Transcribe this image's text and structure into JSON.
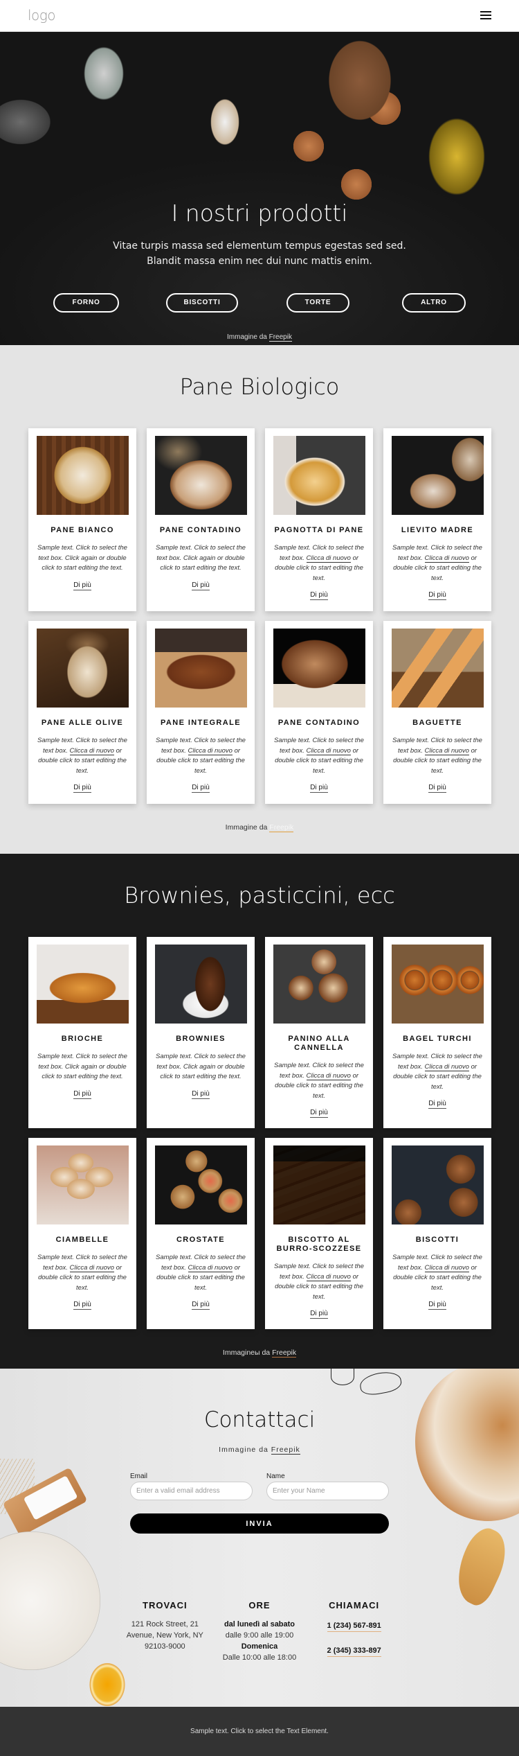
{
  "header": {
    "logo": "logo",
    "menu_icon": "hamburger-menu-icon"
  },
  "hero": {
    "title": "I nostri prodotti",
    "text_line1": "Vitae turpis massa sed elementum tempus egestas sed sed.",
    "text_line2": "Blandit massa enim nec dui nunc mattis enim.",
    "buttons": [
      "FORNO",
      "BISCOTTI",
      "TORTE",
      "ALTRO"
    ],
    "credit_prefix": "Immagine da",
    "credit_link": "Freepik"
  },
  "bread_section": {
    "title": "Pane Biologico",
    "credit_prefix": "Immagine da",
    "credit_link": "Freepik",
    "cards": [
      {
        "name": "PANE BIANCO",
        "desc_pre": "Sample text. Click to select the text box. Click again or double click to start editing the text.",
        "link": "",
        "desc_post": "",
        "more": "Di più"
      },
      {
        "name": "PANE CONTADINO",
        "desc_pre": "Sample text. Click to select the text box. Click again or double click to start editing the text.",
        "link": "",
        "desc_post": "",
        "more": "Di più"
      },
      {
        "name": "PAGNOTTA DI PANE",
        "desc_pre": "Sample text. Click to select the text box. ",
        "link": "Clicca di nuovo",
        "desc_post": " or double click to start editing the text.",
        "more": "Di più"
      },
      {
        "name": "LIEVITO MADRE",
        "desc_pre": "Sample text. Click to select the text box. ",
        "link": "Clicca di nuovo",
        "desc_post": " or double click to start editing the text.",
        "more": "Di più"
      },
      {
        "name": "PANE ALLE OLIVE",
        "desc_pre": "Sample text. Click to select the text box. ",
        "link": "Clicca di nuovo",
        "desc_post": " or double click to start editing the text.",
        "more": "Di più"
      },
      {
        "name": "PANE INTEGRALE",
        "desc_pre": "Sample text. Click to select the text box. ",
        "link": "Clicca di nuovo",
        "desc_post": " or double click to start editing the text.",
        "more": "Di più"
      },
      {
        "name": "PANE CONTADINO",
        "desc_pre": "Sample text. Click to select the text box. ",
        "link": "Clicca di nuovo",
        "desc_post": " or double click to start editing the text.",
        "more": "Di più"
      },
      {
        "name": "BAGUETTE",
        "desc_pre": "Sample text. Click to select the text box. ",
        "link": "Clicca di nuovo",
        "desc_post": " or double click to start editing the text.",
        "more": "Di più"
      }
    ]
  },
  "pastry_section": {
    "title": "Brownies, pasticcini, ecc",
    "credit_prefix": "Immagineы da",
    "credit_link": "Freepik",
    "cards": [
      {
        "name": "BRIOCHE",
        "desc_pre": "Sample text. Click to select the text box. Click again or double click to start editing the text.",
        "link": "",
        "desc_post": "",
        "more": "Di più"
      },
      {
        "name": "BROWNIES",
        "desc_pre": "Sample text. Click to select the text box. Click again or double click to start editing the text.",
        "link": "",
        "desc_post": "",
        "more": "Di più"
      },
      {
        "name": "PANINO ALLA CANNELLA",
        "desc_pre": "Sample text. Click to select the text box. ",
        "link": "Clicca di nuovo",
        "desc_post": " or double click to start editing the text.",
        "more": "Di più"
      },
      {
        "name": "BAGEL TURCHI",
        "desc_pre": "Sample text. Click to select the text box. ",
        "link": "Clicca di nuovo",
        "desc_post": " or double click to start editing the text.",
        "more": "Di più"
      },
      {
        "name": "CIAMBELLE",
        "desc_pre": "Sample text. Click to select the text box. ",
        "link": "Clicca di nuovo",
        "desc_post": " or double click to start editing the text.",
        "more": "Di più"
      },
      {
        "name": "CROSTATE",
        "desc_pre": "Sample text. Click to select the text box. ",
        "link": "Clicca di nuovo",
        "desc_post": " or double click to start editing the text.",
        "more": "Di più"
      },
      {
        "name": "BISCOTTO AL BURRO-SCOZZESE",
        "desc_pre": "Sample text. Click to select the text box. ",
        "link": "Clicca di nuovo",
        "desc_post": " or double click to start editing the text.",
        "more": "Di più"
      },
      {
        "name": "BISCOTTI",
        "desc_pre": "Sample text. Click to select the text box. ",
        "link": "Clicca di nuovo",
        "desc_post": " or double click to start editing the text.",
        "more": "Di più"
      }
    ]
  },
  "contact": {
    "title": "Contattaci",
    "credit_prefix": "Immagine da",
    "credit_link": "Freepik",
    "form": {
      "email_label": "Email",
      "email_placeholder": "Enter a valid email address",
      "email_value": "",
      "name_label": "Name",
      "name_placeholder": "Enter your Name",
      "name_value": "",
      "submit": "INVIA"
    },
    "find_us": {
      "heading": "TROVACI",
      "lines": [
        "121 Rock Street, 21",
        "Avenue, New York, NY",
        "92103-9000"
      ]
    },
    "hours": {
      "heading": "ORE",
      "weekdays_label": "dal lunedì al sabato",
      "weekdays_hours": "dalle 9:00 alle 19:00",
      "sunday_label": "Domenica",
      "sunday_hours": "Dalle 10:00 alle 18:00"
    },
    "call_us": {
      "heading": "CHIAMACI",
      "phones": [
        "1 (234) 567-891",
        "2 (345) 333-897"
      ]
    }
  },
  "footer": {
    "text": "Sample text. Click to select the Text Element."
  }
}
